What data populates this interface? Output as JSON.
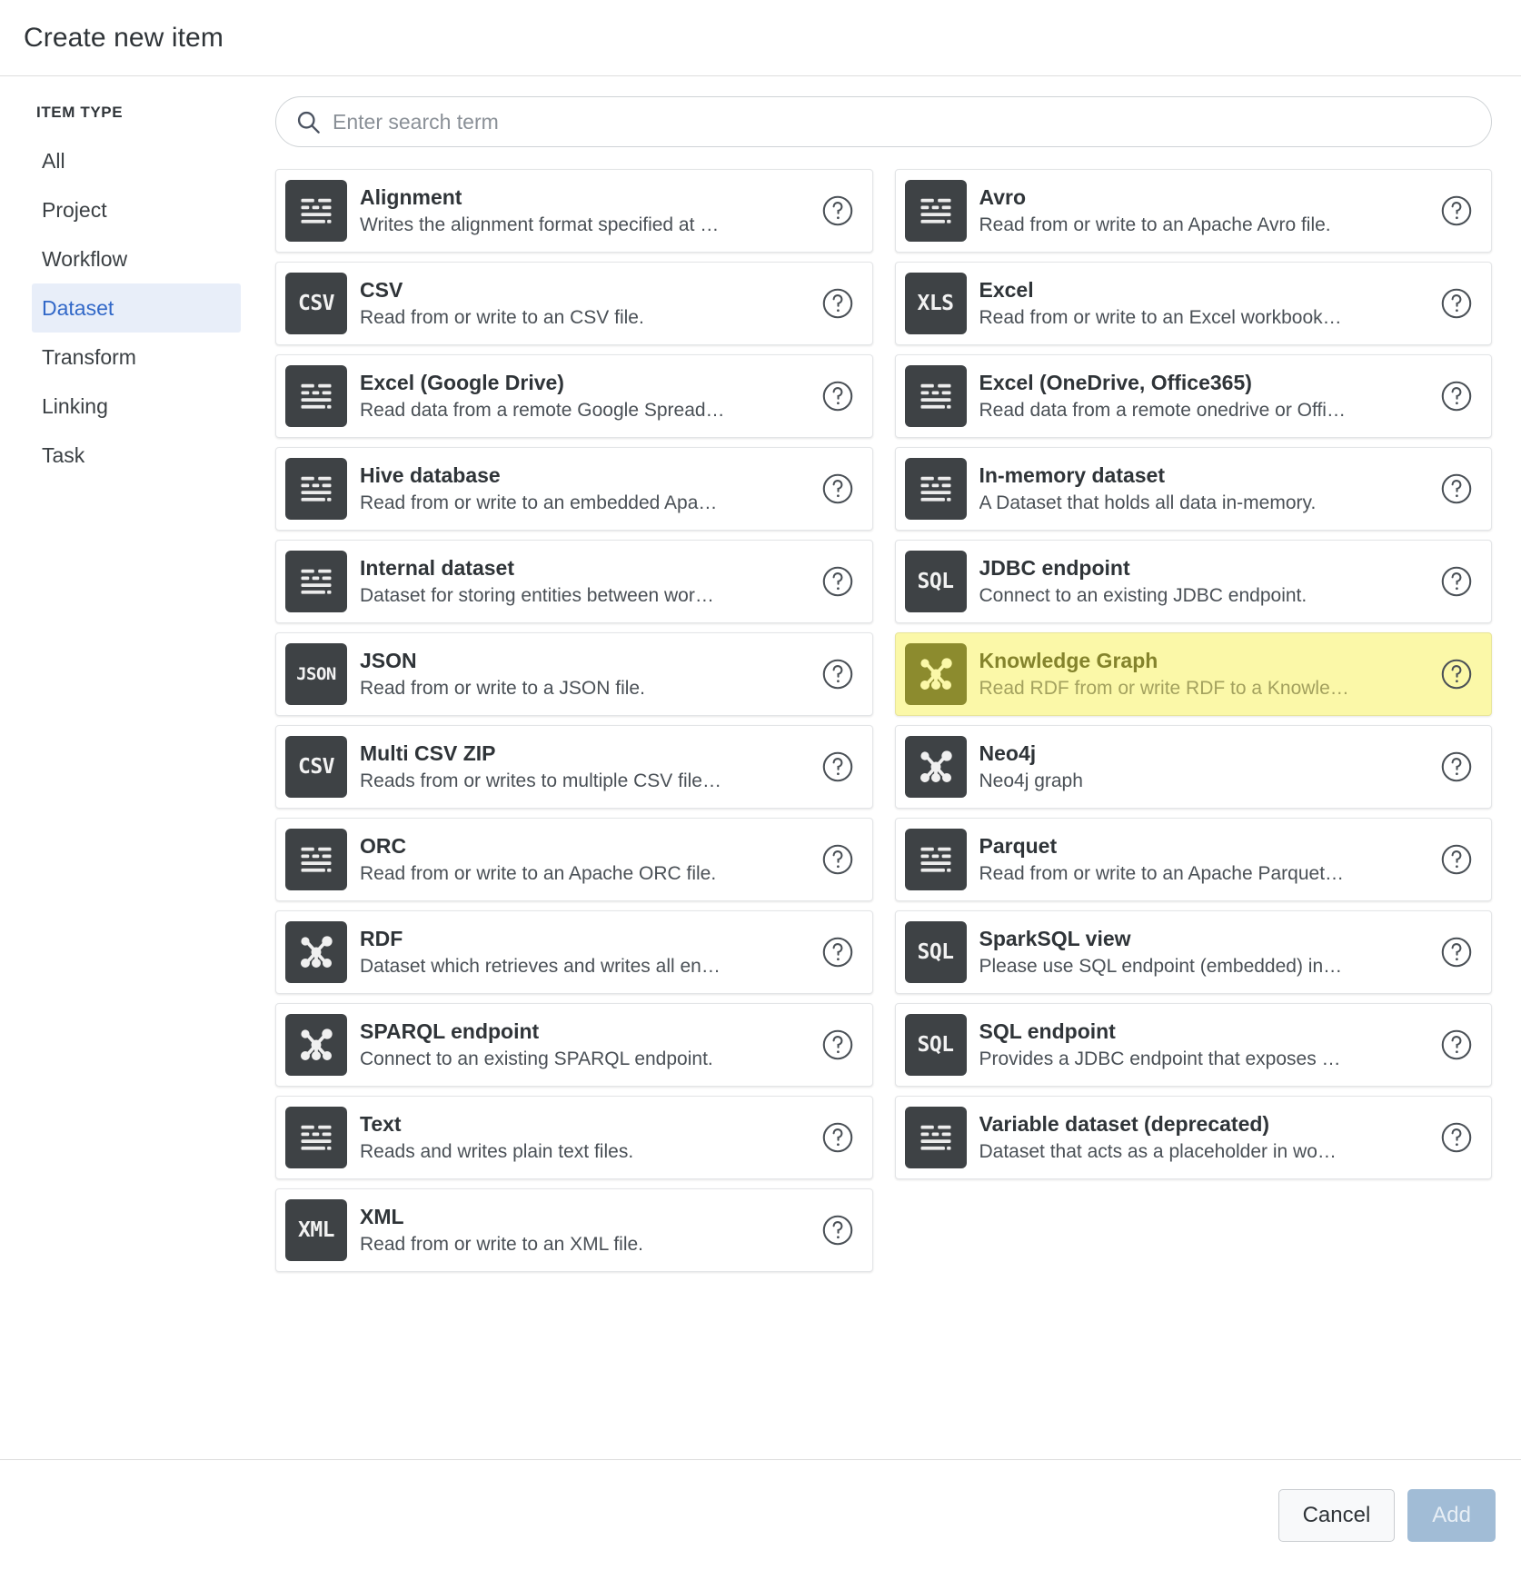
{
  "dialog": {
    "title": "Create new item"
  },
  "sidebar": {
    "heading": "ITEM TYPE",
    "items": [
      {
        "label": "All",
        "active": false
      },
      {
        "label": "Project",
        "active": false
      },
      {
        "label": "Workflow",
        "active": false
      },
      {
        "label": "Dataset",
        "active": true
      },
      {
        "label": "Transform",
        "active": false
      },
      {
        "label": "Linking",
        "active": false
      },
      {
        "label": "Task",
        "active": false
      }
    ]
  },
  "search": {
    "placeholder": "Enter search term",
    "value": "",
    "icon": "search-icon"
  },
  "colors": {
    "accent": "#3268c8",
    "selected_background": "#fbf8a8",
    "selected_icon": "#8c8b2e",
    "selected_text": "#84832c",
    "icon_background": "#3e4245",
    "add_button": "#a1bcd6"
  },
  "items": [
    {
      "name": "Alignment",
      "desc": "Writes the alignment format specified at …",
      "icon": "lines-icon",
      "glyph": "",
      "selected": false,
      "help": "help-icon"
    },
    {
      "name": "Avro",
      "desc": "Read from or write to an Apache Avro file.",
      "icon": "lines-icon",
      "glyph": "",
      "selected": false,
      "help": "help-icon"
    },
    {
      "name": "CSV",
      "desc": "Read from or write to an CSV file.",
      "icon": "csv-icon",
      "glyph": "CSV",
      "selected": false,
      "help": "help-icon"
    },
    {
      "name": "Excel",
      "desc": "Read from or write to an Excel workbook…",
      "icon": "xls-icon",
      "glyph": "XLS",
      "selected": false,
      "help": "help-icon"
    },
    {
      "name": "Excel (Google Drive)",
      "desc": "Read data from a remote Google Spread…",
      "icon": "lines-icon",
      "glyph": "",
      "selected": false,
      "help": "help-icon"
    },
    {
      "name": "Excel (OneDrive, Office365)",
      "desc": "Read data from a remote onedrive or Offi…",
      "icon": "lines-icon",
      "glyph": "",
      "selected": false,
      "help": "help-icon"
    },
    {
      "name": "Hive database",
      "desc": "Read from or write to an embedded Apa…",
      "icon": "lines-icon",
      "glyph": "",
      "selected": false,
      "help": "help-icon"
    },
    {
      "name": "In-memory dataset",
      "desc": "A Dataset that holds all data in-memory.",
      "icon": "lines-icon",
      "glyph": "",
      "selected": false,
      "help": "help-icon"
    },
    {
      "name": "Internal dataset",
      "desc": "Dataset for storing entities between wor…",
      "icon": "lines-icon",
      "glyph": "",
      "selected": false,
      "help": "help-icon"
    },
    {
      "name": "JDBC endpoint",
      "desc": "Connect to an existing JDBC endpoint.",
      "icon": "sql-icon",
      "glyph": "SQL",
      "selected": false,
      "help": "help-icon"
    },
    {
      "name": "JSON",
      "desc": "Read from or write to a JSON file.",
      "icon": "json-icon",
      "glyph": "JSON",
      "selected": false,
      "help": "help-icon"
    },
    {
      "name": "Knowledge Graph",
      "desc": "Read RDF from or write RDF to a Knowle…",
      "icon": "graph-icon",
      "glyph": "",
      "selected": true,
      "help": "help-icon"
    },
    {
      "name": "Multi CSV ZIP",
      "desc": "Reads from or writes to multiple CSV file…",
      "icon": "csv-icon",
      "glyph": "CSV",
      "selected": false,
      "help": "help-icon"
    },
    {
      "name": "Neo4j",
      "desc": "Neo4j graph",
      "icon": "graph-icon",
      "glyph": "",
      "selected": false,
      "help": "help-icon"
    },
    {
      "name": "ORC",
      "desc": "Read from or write to an Apache ORC file.",
      "icon": "lines-icon",
      "glyph": "",
      "selected": false,
      "help": "help-icon"
    },
    {
      "name": "Parquet",
      "desc": "Read from or write to an Apache Parquet…",
      "icon": "lines-icon",
      "glyph": "",
      "selected": false,
      "help": "help-icon"
    },
    {
      "name": "RDF",
      "desc": "Dataset which retrieves and writes all en…",
      "icon": "graph-icon",
      "glyph": "",
      "selected": false,
      "help": "help-icon"
    },
    {
      "name": "SparkSQL view",
      "desc": "Please use SQL endpoint (embedded) in…",
      "icon": "sql-icon",
      "glyph": "SQL",
      "selected": false,
      "help": "help-icon"
    },
    {
      "name": "SPARQL endpoint",
      "desc": "Connect to an existing SPARQL endpoint.",
      "icon": "graph-icon",
      "glyph": "",
      "selected": false,
      "help": "help-icon"
    },
    {
      "name": "SQL endpoint",
      "desc": "Provides a JDBC endpoint that exposes …",
      "icon": "sql-icon",
      "glyph": "SQL",
      "selected": false,
      "help": "help-icon"
    },
    {
      "name": "Text",
      "desc": "Reads and writes plain text files.",
      "icon": "lines-icon",
      "glyph": "",
      "selected": false,
      "help": "help-icon"
    },
    {
      "name": "Variable dataset (deprecated)",
      "desc": "Dataset that acts as a placeholder in wo…",
      "icon": "lines-icon",
      "glyph": "",
      "selected": false,
      "help": "help-icon"
    },
    {
      "name": "XML",
      "desc": "Read from or write to an XML file.",
      "icon": "xml-icon",
      "glyph": "XML",
      "selected": false,
      "help": "help-icon"
    }
  ],
  "footer": {
    "cancel_label": "Cancel",
    "add_label": "Add"
  }
}
